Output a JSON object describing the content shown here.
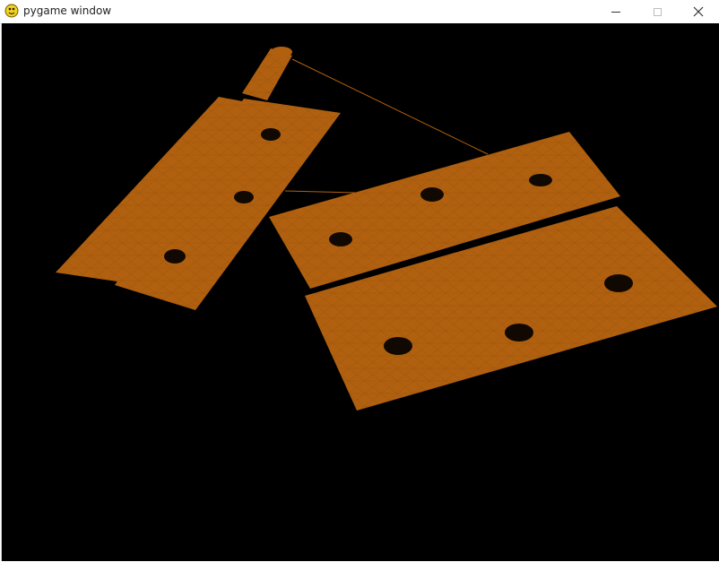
{
  "window": {
    "title": "pygame window",
    "controls": {
      "minimize": "minimize",
      "maximize": "maximize",
      "close": "close"
    }
  },
  "scene": {
    "background": "#000000",
    "mesh_color": "#b0600f",
    "hole_color": "#000000",
    "objects": [
      "hinge-leaf-left",
      "hinge-plate-upper",
      "hinge-plate-lower"
    ]
  },
  "icons": {
    "app": "pygame-snake-icon",
    "minimize": "minimize-icon",
    "maximize": "maximize-icon",
    "close": "close-icon"
  }
}
